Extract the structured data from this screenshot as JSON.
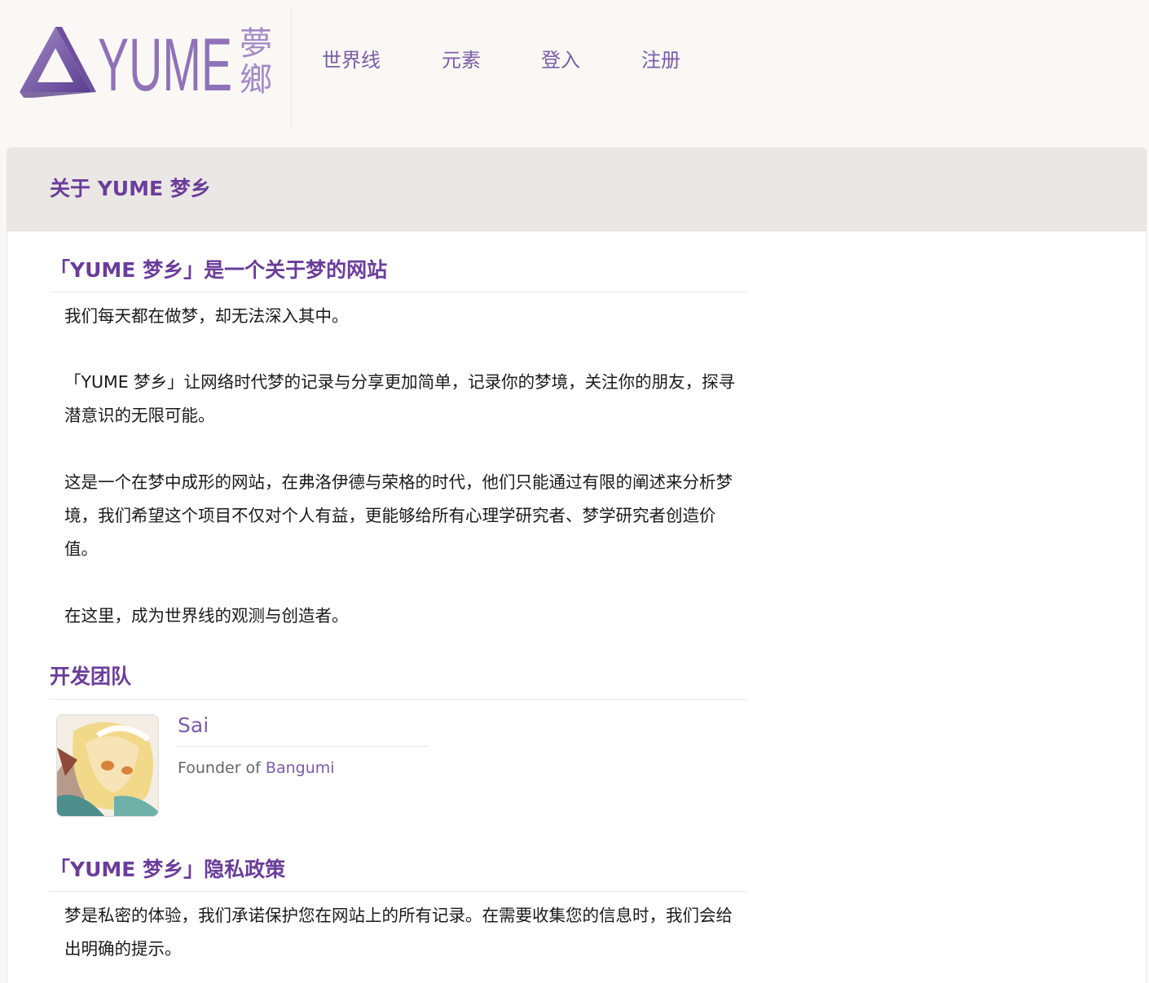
{
  "colors": {
    "accent": "#6a3d9a",
    "nav_link": "#7a5ca8",
    "background": "#faf8f5",
    "panel_header": "#eae7e4"
  },
  "header": {
    "logo": {
      "wordmark": "YUME",
      "kanji_top": "夢",
      "kanji_bottom": "鄉"
    },
    "nav": [
      {
        "label": "世界线"
      },
      {
        "label": "元素"
      },
      {
        "label": "登入"
      },
      {
        "label": "注册"
      }
    ]
  },
  "panel": {
    "title": "关于 YUME 梦乡",
    "about": {
      "heading": "「YUME 梦乡」是一个关于梦的网站",
      "paragraphs": [
        "我们每天都在做梦，却无法深入其中。",
        "「YUME 梦乡」让网络时代梦的记录与分享更加简单，记录你的梦境，关注你的朋友，探寻潜意识的无限可能。",
        "这是一个在梦中成形的网站，在弗洛伊德与荣格的时代，他们只能通过有限的阐述来分析梦境，我们希望这个项目不仅对个人有益，更能够给所有心理学研究者、梦学研究者创造价值。",
        "在这里，成为世界线的观测与创造者。"
      ]
    },
    "team": {
      "heading": "开发团队",
      "members": [
        {
          "name": "Sai",
          "role_prefix": "Founder of ",
          "role_link": "Bangumi"
        }
      ]
    },
    "privacy": {
      "heading": "「YUME 梦乡」隐私政策",
      "paragraphs": [
        "梦是私密的体验，我们承诺保护您在网站上的所有记录。在需要收集您的信息时，我们会给出明确的提示。"
      ]
    }
  }
}
